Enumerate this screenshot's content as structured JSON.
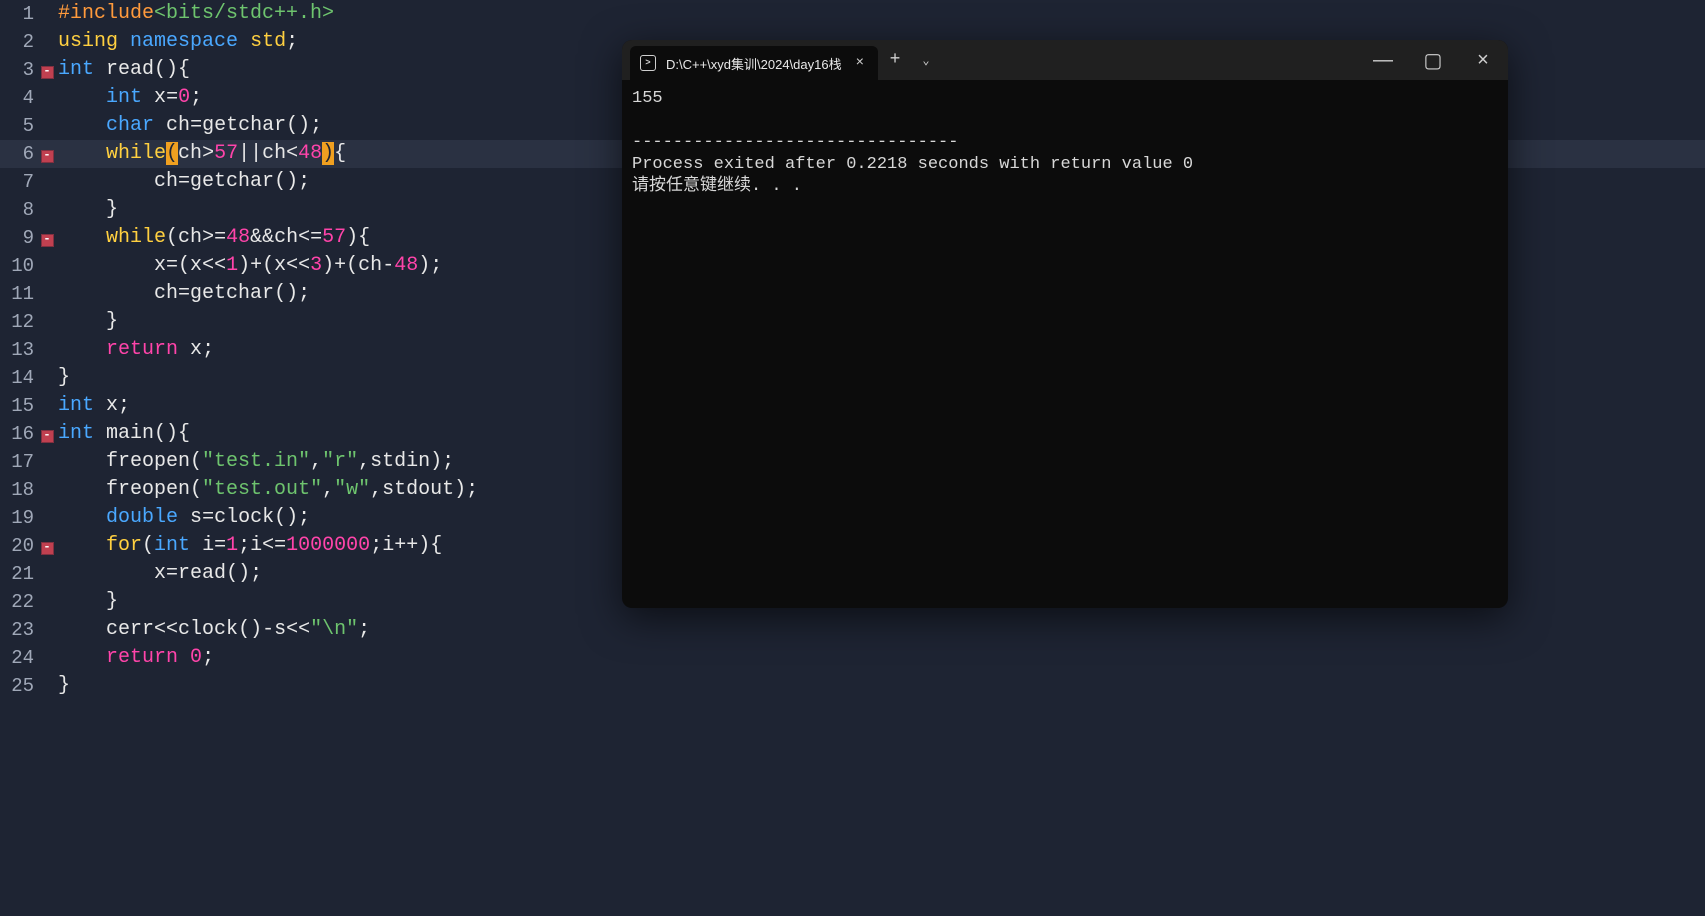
{
  "editor": {
    "lines": [
      {
        "n": 1,
        "fold": false,
        "tokens": [
          {
            "t": "#include",
            "c": "tk-pp"
          },
          {
            "t": "<bits/stdc++.h>",
            "c": "tk-inc"
          }
        ]
      },
      {
        "n": 2,
        "fold": false,
        "tokens": [
          {
            "t": "using",
            "c": "tk-using"
          },
          {
            "t": " ",
            "c": ""
          },
          {
            "t": "namespace",
            "c": "tk-ns"
          },
          {
            "t": " ",
            "c": ""
          },
          {
            "t": "std",
            "c": "tk-std"
          },
          {
            "t": ";",
            "c": "tk-punc"
          }
        ]
      },
      {
        "n": 3,
        "fold": true,
        "tokens": [
          {
            "t": "int",
            "c": "tk-type"
          },
          {
            "t": " ",
            "c": ""
          },
          {
            "t": "read",
            "c": "tk-fn"
          },
          {
            "t": "(){",
            "c": "tk-punc"
          }
        ]
      },
      {
        "n": 4,
        "fold": false,
        "indent": 1,
        "tokens": [
          {
            "t": "int",
            "c": "tk-type"
          },
          {
            "t": " ",
            "c": ""
          },
          {
            "t": "x",
            "c": "tk-ident"
          },
          {
            "t": "=",
            "c": "tk-op"
          },
          {
            "t": "0",
            "c": "tk-num"
          },
          {
            "t": ";",
            "c": "tk-punc"
          }
        ]
      },
      {
        "n": 5,
        "fold": false,
        "indent": 1,
        "tokens": [
          {
            "t": "char",
            "c": "tk-type"
          },
          {
            "t": " ",
            "c": ""
          },
          {
            "t": "ch",
            "c": "tk-ident"
          },
          {
            "t": "=",
            "c": "tk-op"
          },
          {
            "t": "getchar",
            "c": "tk-fn"
          },
          {
            "t": "();",
            "c": "tk-punc"
          }
        ]
      },
      {
        "n": 6,
        "fold": true,
        "hl": true,
        "indent": 1,
        "tokens": [
          {
            "t": "while",
            "c": "tk-while"
          },
          {
            "t": "(",
            "c": "tk-paren-hl"
          },
          {
            "t": "ch",
            "c": "tk-ident"
          },
          {
            "t": ">",
            "c": "tk-op"
          },
          {
            "t": "57",
            "c": "tk-num"
          },
          {
            "t": "||",
            "c": "tk-op"
          },
          {
            "t": "ch",
            "c": "tk-ident"
          },
          {
            "t": "<",
            "c": "tk-op"
          },
          {
            "t": "48",
            "c": "tk-num"
          },
          {
            "t": ")",
            "c": "tk-paren-hl"
          },
          {
            "t": "{",
            "c": "tk-punc"
          }
        ]
      },
      {
        "n": 7,
        "fold": false,
        "indent": 2,
        "tokens": [
          {
            "t": "ch",
            "c": "tk-ident"
          },
          {
            "t": "=",
            "c": "tk-op"
          },
          {
            "t": "getchar",
            "c": "tk-fn"
          },
          {
            "t": "();",
            "c": "tk-punc"
          }
        ]
      },
      {
        "n": 8,
        "fold": false,
        "indent": 1,
        "tokens": [
          {
            "t": "}",
            "c": "tk-punc"
          }
        ]
      },
      {
        "n": 9,
        "fold": true,
        "indent": 1,
        "tokens": [
          {
            "t": "while",
            "c": "tk-while"
          },
          {
            "t": "(",
            "c": "tk-punc"
          },
          {
            "t": "ch",
            "c": "tk-ident"
          },
          {
            "t": ">=",
            "c": "tk-op"
          },
          {
            "t": "48",
            "c": "tk-num"
          },
          {
            "t": "&&",
            "c": "tk-op"
          },
          {
            "t": "ch",
            "c": "tk-ident"
          },
          {
            "t": "<=",
            "c": "tk-op"
          },
          {
            "t": "57",
            "c": "tk-num"
          },
          {
            "t": "){",
            "c": "tk-punc"
          }
        ]
      },
      {
        "n": 10,
        "fold": false,
        "indent": 2,
        "tokens": [
          {
            "t": "x",
            "c": "tk-ident"
          },
          {
            "t": "=(",
            "c": "tk-punc"
          },
          {
            "t": "x",
            "c": "tk-ident"
          },
          {
            "t": "<<",
            "c": "tk-op"
          },
          {
            "t": "1",
            "c": "tk-num"
          },
          {
            "t": ")+(",
            "c": "tk-punc"
          },
          {
            "t": "x",
            "c": "tk-ident"
          },
          {
            "t": "<<",
            "c": "tk-op"
          },
          {
            "t": "3",
            "c": "tk-num"
          },
          {
            "t": ")+(",
            "c": "tk-punc"
          },
          {
            "t": "ch",
            "c": "tk-ident"
          },
          {
            "t": "-",
            "c": "tk-op"
          },
          {
            "t": "48",
            "c": "tk-num"
          },
          {
            "t": ");",
            "c": "tk-punc"
          }
        ]
      },
      {
        "n": 11,
        "fold": false,
        "indent": 2,
        "tokens": [
          {
            "t": "ch",
            "c": "tk-ident"
          },
          {
            "t": "=",
            "c": "tk-op"
          },
          {
            "t": "getchar",
            "c": "tk-fn"
          },
          {
            "t": "();",
            "c": "tk-punc"
          }
        ]
      },
      {
        "n": 12,
        "fold": false,
        "indent": 1,
        "tokens": [
          {
            "t": "}",
            "c": "tk-punc"
          }
        ]
      },
      {
        "n": 13,
        "fold": false,
        "indent": 1,
        "tokens": [
          {
            "t": "return",
            "c": "tk-ret"
          },
          {
            "t": " ",
            "c": ""
          },
          {
            "t": "x",
            "c": "tk-ident"
          },
          {
            "t": ";",
            "c": "tk-punc"
          }
        ]
      },
      {
        "n": 14,
        "fold": false,
        "tokens": [
          {
            "t": "}",
            "c": "tk-punc"
          }
        ]
      },
      {
        "n": 15,
        "fold": false,
        "tokens": [
          {
            "t": "int",
            "c": "tk-type"
          },
          {
            "t": " ",
            "c": ""
          },
          {
            "t": "x",
            "c": "tk-ident"
          },
          {
            "t": ";",
            "c": "tk-punc"
          }
        ]
      },
      {
        "n": 16,
        "fold": true,
        "tokens": [
          {
            "t": "int",
            "c": "tk-type"
          },
          {
            "t": " ",
            "c": ""
          },
          {
            "t": "main",
            "c": "tk-fn"
          },
          {
            "t": "(){",
            "c": "tk-punc"
          }
        ]
      },
      {
        "n": 17,
        "fold": false,
        "indent": 1,
        "tokens": [
          {
            "t": "freopen",
            "c": "tk-fn"
          },
          {
            "t": "(",
            "c": "tk-punc"
          },
          {
            "t": "\"test.in\"",
            "c": "tk-str"
          },
          {
            "t": ",",
            "c": "tk-punc"
          },
          {
            "t": "\"r\"",
            "c": "tk-str"
          },
          {
            "t": ",",
            "c": "tk-punc"
          },
          {
            "t": "stdin",
            "c": "tk-ident"
          },
          {
            "t": ");",
            "c": "tk-punc"
          }
        ]
      },
      {
        "n": 18,
        "fold": false,
        "indent": 1,
        "tokens": [
          {
            "t": "freopen",
            "c": "tk-fn"
          },
          {
            "t": "(",
            "c": "tk-punc"
          },
          {
            "t": "\"test.out\"",
            "c": "tk-str"
          },
          {
            "t": ",",
            "c": "tk-punc"
          },
          {
            "t": "\"w\"",
            "c": "tk-str"
          },
          {
            "t": ",",
            "c": "tk-punc"
          },
          {
            "t": "stdout",
            "c": "tk-ident"
          },
          {
            "t": ");",
            "c": "tk-punc"
          }
        ]
      },
      {
        "n": 19,
        "fold": false,
        "indent": 1,
        "tokens": [
          {
            "t": "double",
            "c": "tk-type"
          },
          {
            "t": " ",
            "c": ""
          },
          {
            "t": "s",
            "c": "tk-ident"
          },
          {
            "t": "=",
            "c": "tk-op"
          },
          {
            "t": "clock",
            "c": "tk-fn"
          },
          {
            "t": "();",
            "c": "tk-punc"
          }
        ]
      },
      {
        "n": 20,
        "fold": true,
        "indent": 1,
        "tokens": [
          {
            "t": "for",
            "c": "tk-while"
          },
          {
            "t": "(",
            "c": "tk-punc"
          },
          {
            "t": "int",
            "c": "tk-type"
          },
          {
            "t": " ",
            "c": ""
          },
          {
            "t": "i",
            "c": "tk-ident"
          },
          {
            "t": "=",
            "c": "tk-op"
          },
          {
            "t": "1",
            "c": "tk-num"
          },
          {
            "t": ";",
            "c": "tk-punc"
          },
          {
            "t": "i",
            "c": "tk-ident"
          },
          {
            "t": "<=",
            "c": "tk-op"
          },
          {
            "t": "1000000",
            "c": "tk-num"
          },
          {
            "t": ";",
            "c": "tk-punc"
          },
          {
            "t": "i",
            "c": "tk-ident"
          },
          {
            "t": "++){",
            "c": "tk-punc"
          }
        ]
      },
      {
        "n": 21,
        "fold": false,
        "indent": 2,
        "tokens": [
          {
            "t": "x",
            "c": "tk-ident"
          },
          {
            "t": "=",
            "c": "tk-op"
          },
          {
            "t": "read",
            "c": "tk-fn"
          },
          {
            "t": "();",
            "c": "tk-punc"
          }
        ]
      },
      {
        "n": 22,
        "fold": false,
        "indent": 1,
        "tokens": [
          {
            "t": "}",
            "c": "tk-punc"
          }
        ]
      },
      {
        "n": 23,
        "fold": false,
        "indent": 1,
        "tokens": [
          {
            "t": "cerr",
            "c": "tk-ident"
          },
          {
            "t": "<<",
            "c": "tk-op"
          },
          {
            "t": "clock",
            "c": "tk-fn"
          },
          {
            "t": "()-",
            "c": "tk-punc"
          },
          {
            "t": "s",
            "c": "tk-ident"
          },
          {
            "t": "<<",
            "c": "tk-op"
          },
          {
            "t": "\"\\n\"",
            "c": "tk-str"
          },
          {
            "t": ";",
            "c": "tk-punc"
          }
        ]
      },
      {
        "n": 24,
        "fold": false,
        "indent": 1,
        "tokens": [
          {
            "t": "return",
            "c": "tk-ret"
          },
          {
            "t": " ",
            "c": ""
          },
          {
            "t": "0",
            "c": "tk-num"
          },
          {
            "t": ";",
            "c": "tk-punc"
          }
        ]
      },
      {
        "n": 25,
        "fold": false,
        "tokens": [
          {
            "t": "}",
            "c": "tk-punc"
          }
        ]
      }
    ]
  },
  "terminal": {
    "tab_title": "D:\\C++\\xyd集训\\2024\\day16栈",
    "output": "155\n\n--------------------------------\nProcess exited after 0.2218 seconds with return value 0\n请按任意键继续. . . "
  },
  "glyphs": {
    "close": "×",
    "plus": "+",
    "chevron": "⌄",
    "min": "—",
    "max": "▢"
  }
}
